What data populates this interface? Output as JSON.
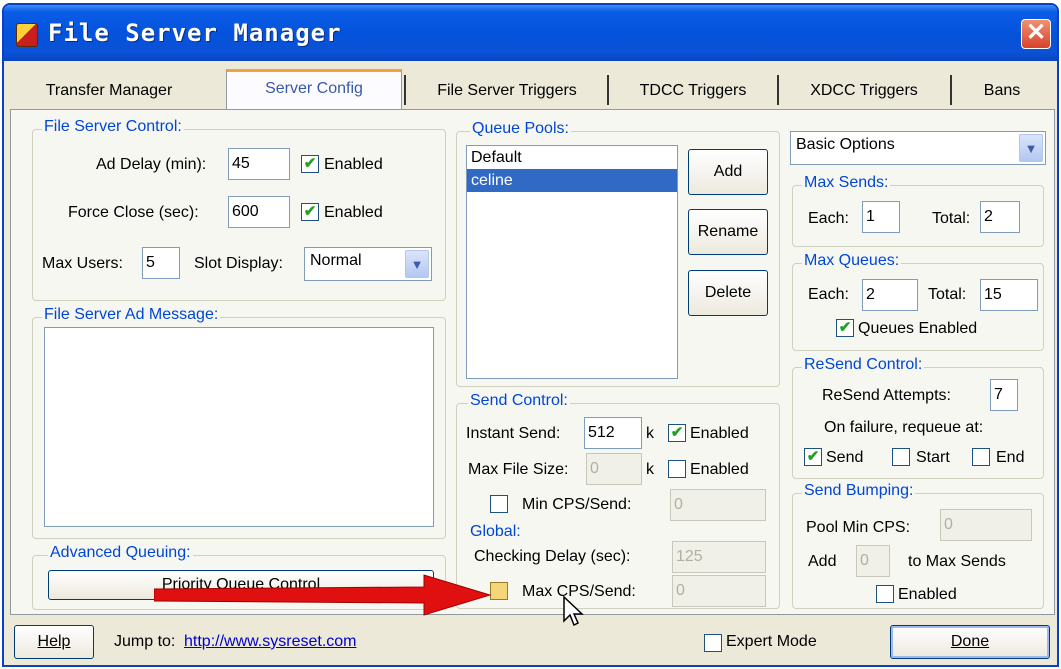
{
  "window": {
    "title": "File Server Manager",
    "close_glyph": "✕"
  },
  "tabs": [
    {
      "label": "Transfer Manager"
    },
    {
      "label": "Server Config"
    },
    {
      "label": "File Server Triggers"
    },
    {
      "label": "TDCC Triggers"
    },
    {
      "label": "XDCC Triggers"
    },
    {
      "label": "Bans"
    }
  ],
  "file_server_control": {
    "group_label": "File Server Control:",
    "ad_delay_label": "Ad Delay (min):",
    "ad_delay_value": "45",
    "ad_delay_enabled_label": "Enabled",
    "force_close_label": "Force Close (sec):",
    "force_close_value": "600",
    "force_close_enabled_label": "Enabled",
    "max_users_label": "Max Users:",
    "max_users_value": "5",
    "slot_display_label": "Slot Display:",
    "slot_display_value": "Normal"
  },
  "ad_message": {
    "group_label": "File Server Ad Message:",
    "value": ""
  },
  "advanced_queuing": {
    "group_label": "Advanced Queuing:",
    "button_label": "Priority Queue Control"
  },
  "queue_pools": {
    "group_label": "Queue Pools:",
    "items": [
      "Default",
      "celine"
    ],
    "selected": "celine",
    "add_label": "Add",
    "rename_label": "Rename",
    "delete_label": "Delete"
  },
  "send_control": {
    "group_label": "Send Control:",
    "instant_send_label": "Instant Send:",
    "instant_send_value": "512",
    "instant_unit": "k",
    "instant_enabled_label": "Enabled",
    "max_file_size_label": "Max File Size:",
    "max_file_size_value": "0",
    "max_file_unit": "k",
    "max_file_enabled_label": "Enabled",
    "min_cps_label": "Min CPS/Send:",
    "min_cps_value": "0"
  },
  "global": {
    "group_label": "Global:",
    "checking_delay_label": "Checking Delay (sec):",
    "checking_delay_value": "125",
    "max_cps_label": "Max CPS/Send:",
    "max_cps_value": "0"
  },
  "options": {
    "dropdown_value": "Basic Options"
  },
  "max_sends": {
    "group_label": "Max Sends:",
    "each_label": "Each:",
    "each_value": "1",
    "total_label": "Total:",
    "total_value": "2"
  },
  "max_queues": {
    "group_label": "Max Queues:",
    "each_label": "Each:",
    "each_value": "2",
    "total_label": "Total:",
    "total_value": "15",
    "enabled_label": "Queues Enabled"
  },
  "resend_control": {
    "group_label": "ReSend Control:",
    "attempts_label": "ReSend Attempts:",
    "attempts_value": "7",
    "failure_label": "On failure, requeue at:",
    "send_label": "Send",
    "start_label": "Start",
    "end_label": "End"
  },
  "send_bumping": {
    "group_label": "Send Bumping:",
    "pool_min_cps_label": "Pool Min CPS:",
    "pool_min_cps_value": "0",
    "add_label": "Add",
    "add_value": "0",
    "to_max_sends_label": "to Max Sends",
    "enabled_label": "Enabled"
  },
  "footer": {
    "help_label": "Help",
    "jump_label": "Jump to:",
    "jump_url": "http://www.sysreset.com",
    "expert_mode_label": "Expert Mode",
    "done_label": "Done"
  },
  "colors": {
    "title_bar": "#0553dc",
    "group_label": "#0046d5",
    "selection": "#316ac5",
    "annotation_arrow": "#e01010",
    "check_mark": "#21a121"
  }
}
